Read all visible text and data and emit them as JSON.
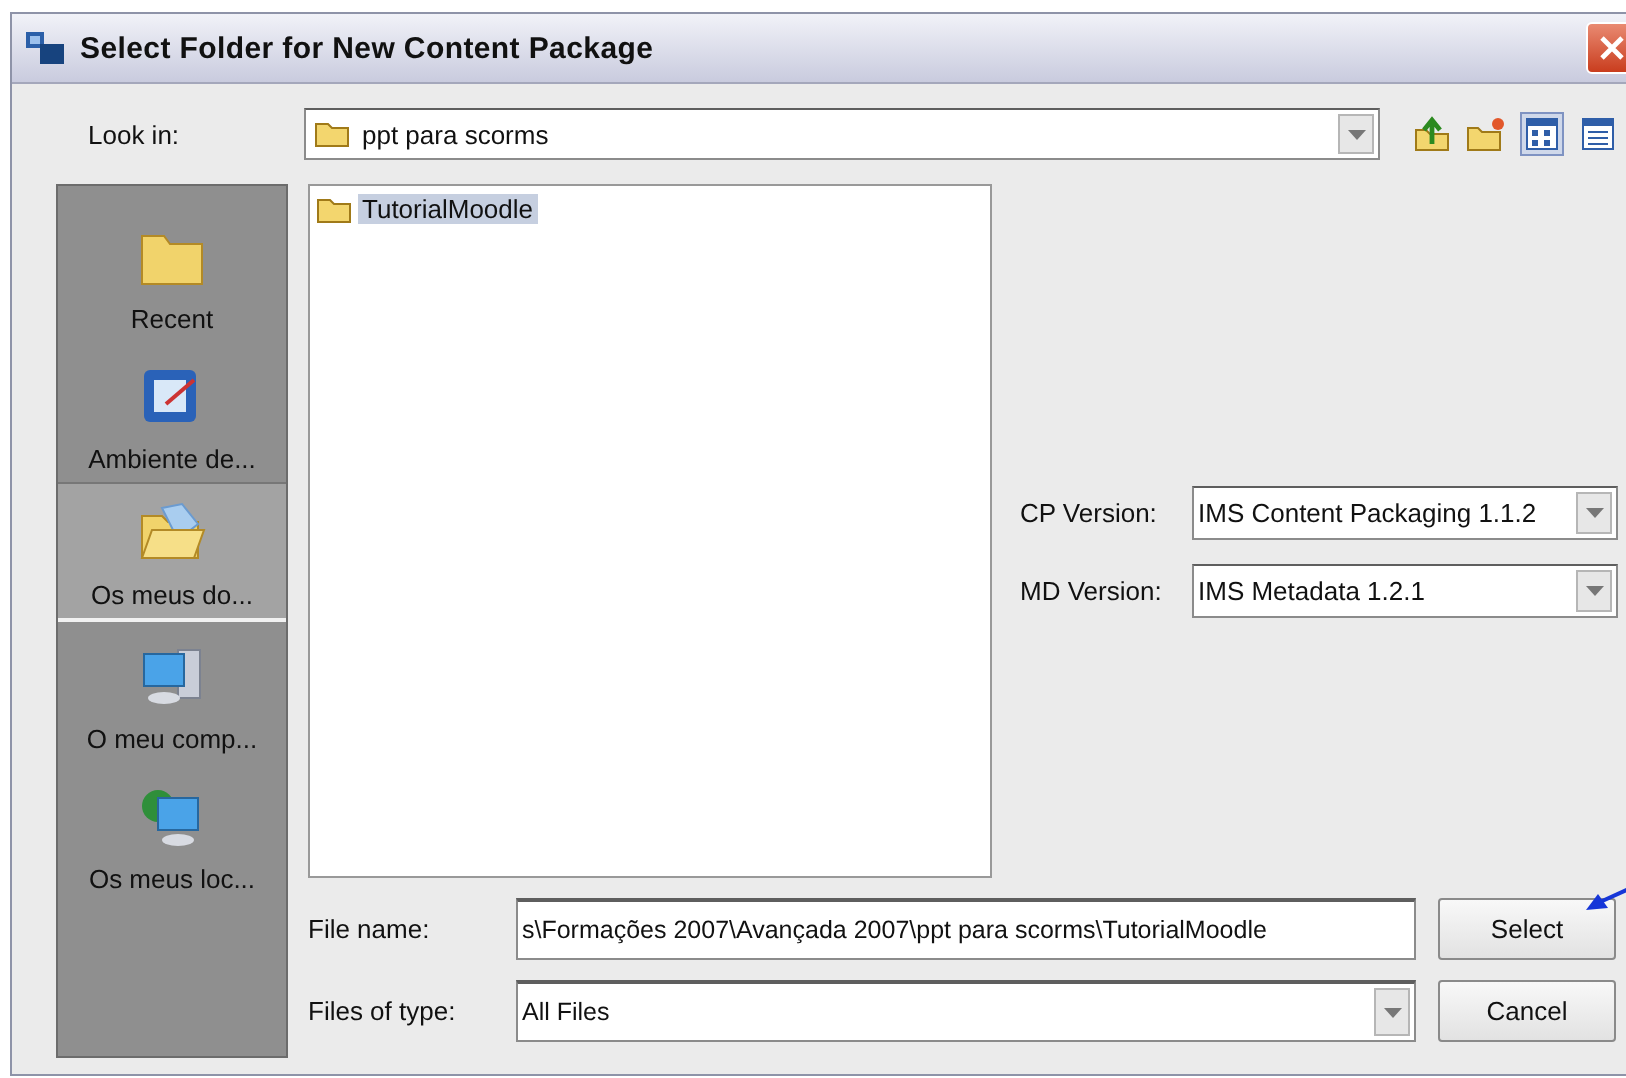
{
  "window": {
    "title": "Select Folder for New Content Package"
  },
  "look_in": {
    "label": "Look in:",
    "value": "ppt para scorms"
  },
  "view_buttons": [
    {
      "selected": true
    },
    {
      "selected": false
    }
  ],
  "places": [
    {
      "label": "Recent",
      "selected": false
    },
    {
      "label": "Ambiente de...",
      "selected": false
    },
    {
      "label": "Os meus do...",
      "selected": true
    },
    {
      "label": "O meu comp...",
      "selected": false
    },
    {
      "label": "Os meus loc...",
      "selected": false
    }
  ],
  "files": [
    {
      "name": "TutorialMoodle",
      "selected": true
    }
  ],
  "options": [
    {
      "label": "CP Version:",
      "value": "IMS Content Packaging 1.1.2"
    },
    {
      "label": "MD Version:",
      "value": "IMS Metadata 1.2.1"
    }
  ],
  "file_name": {
    "label": "File name:",
    "value": "s\\Formações 2007\\Avançada 2007\\ppt para scorms\\TutorialMoodle"
  },
  "file_type": {
    "label": "Files of type:",
    "value": "All Files"
  },
  "buttons": [
    "Select",
    "Cancel"
  ]
}
